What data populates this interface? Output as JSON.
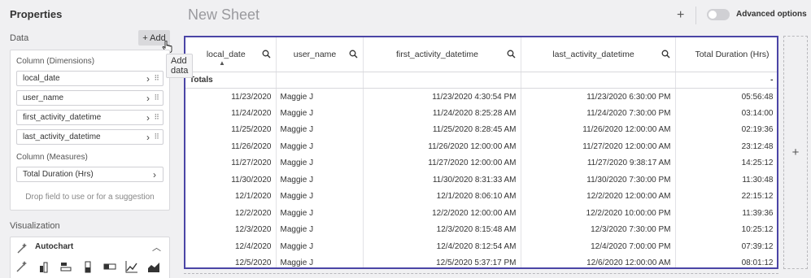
{
  "left_panel": {
    "title": "Properties",
    "data_label": "Data",
    "add_button": "+ Add",
    "tooltip": "Add data",
    "dimensions_heading": "Column (Dimensions)",
    "dimensions": [
      "local_date",
      "user_name",
      "first_activity_datetime",
      "last_activity_datetime"
    ],
    "measures_heading": "Column (Measures)",
    "measures": [
      "Total Duration (Hrs)"
    ],
    "drop_hint": "Drop field to use or for a suggestion",
    "visualization_label": "Visualization",
    "autochart_label": "Autochart",
    "chart_icons": [
      "autochart-icon",
      "bar-chart-icon",
      "horizontal-bar-icon",
      "column-chart-icon",
      "horizontal-bar-single-icon",
      "line-chart-icon",
      "area-chart-icon"
    ]
  },
  "header": {
    "sheet_title": "New Sheet",
    "add_icon": "+",
    "advanced_options_label": "Advanced options",
    "advanced_options_on": false
  },
  "table": {
    "columns": [
      "local_date",
      "user_name",
      "first_activity_datetime",
      "last_activity_datetime",
      "Total Duration (Hrs)"
    ],
    "totals_label": "Totals",
    "totals_value": "-",
    "rows": [
      [
        "11/23/2020",
        "Maggie J",
        "11/23/2020 4:30:54 PM",
        "11/23/2020 6:30:00 PM",
        "05:56:48"
      ],
      [
        "11/24/2020",
        "Maggie J",
        "11/24/2020 8:25:28 AM",
        "11/24/2020 7:30:00 PM",
        "03:14:00"
      ],
      [
        "11/25/2020",
        "Maggie J",
        "11/25/2020 8:28:45 AM",
        "11/26/2020 12:00:00 AM",
        "02:19:36"
      ],
      [
        "11/26/2020",
        "Maggie J",
        "11/26/2020 12:00:00 AM",
        "11/27/2020 12:00:00 AM",
        "23:12:48"
      ],
      [
        "11/27/2020",
        "Maggie J",
        "11/27/2020 12:00:00 AM",
        "11/27/2020 9:38:17 AM",
        "14:25:12"
      ],
      [
        "11/30/2020",
        "Maggie J",
        "11/30/2020 8:31:33 AM",
        "11/30/2020 7:30:00 PM",
        "11:30:48"
      ],
      [
        "12/1/2020",
        "Maggie J",
        "12/1/2020 8:06:10 AM",
        "12/2/2020 12:00:00 AM",
        "22:15:12"
      ],
      [
        "12/2/2020",
        "Maggie J",
        "12/2/2020 12:00:00 AM",
        "12/2/2020 10:00:00 PM",
        "11:39:36"
      ],
      [
        "12/3/2020",
        "Maggie J",
        "12/3/2020 8:15:48 AM",
        "12/3/2020 7:30:00 PM",
        "10:25:12"
      ],
      [
        "12/4/2020",
        "Maggie J",
        "12/4/2020 8:12:54 AM",
        "12/4/2020 7:00:00 PM",
        "07:39:12"
      ],
      [
        "12/5/2020",
        "Maggie J",
        "12/5/2020 5:37:17 PM",
        "12/6/2020 12:00:00 AM",
        "08:01:12"
      ]
    ]
  },
  "add_column_icon": "+",
  "colors": {
    "table_border": "#4b45a6",
    "background": "#f0f0f2"
  }
}
